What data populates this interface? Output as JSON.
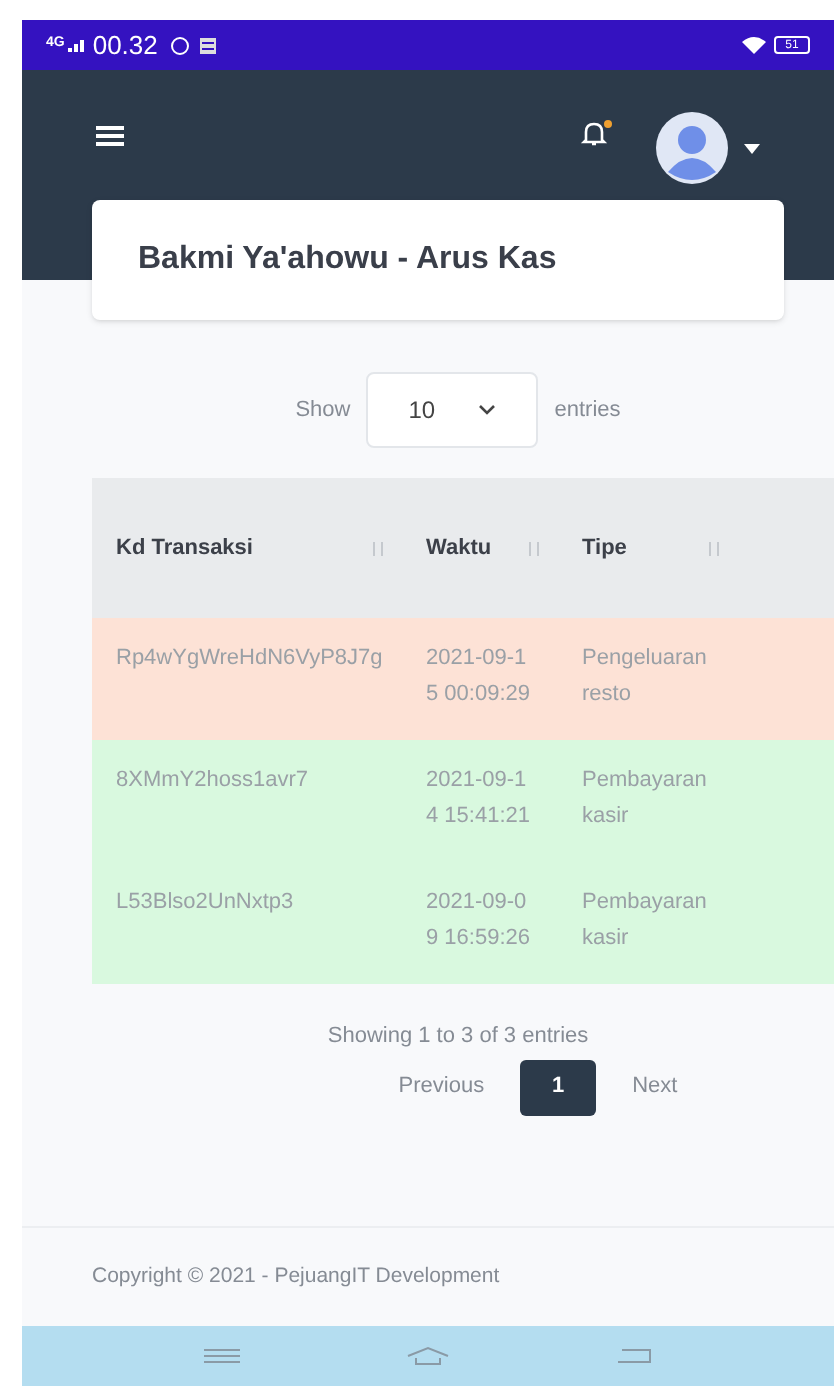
{
  "status_bar": {
    "network": "4G",
    "time": "00.32",
    "battery": "51"
  },
  "navbar": {
    "notification_dot": true
  },
  "card": {
    "title": "Bakmi Ya'ahowu - Arus Kas"
  },
  "length_menu": {
    "prefix": "Show",
    "value": "10",
    "suffix": "entries"
  },
  "table": {
    "columns": [
      {
        "label": "Kd Transaksi"
      },
      {
        "label": "Waktu"
      },
      {
        "label": "Tipe"
      }
    ],
    "rows": [
      {
        "color": "#fde2d6",
        "cells": [
          "Rp4wYgWreHdN6VyP8J7g",
          "2021-09-15 00:09:29",
          "Pengeluaran resto"
        ]
      },
      {
        "color": "#d9f9df",
        "cells": [
          "8XMmY2hoss1avr7",
          "2021-09-14 15:41:21",
          "Pembayaran kasir"
        ]
      },
      {
        "color": "#d9f9df",
        "cells": [
          "L53Blso2UnNxtp3",
          "2021-09-09 16:59:26",
          "Pembayaran kasir"
        ]
      }
    ]
  },
  "info": "Showing 1 to 3 of 3 entries",
  "pagination": [
    {
      "label": "Previous",
      "kind": "prev",
      "selected": false
    },
    {
      "label": "1",
      "kind": "page",
      "selected": true
    },
    {
      "label": "Next",
      "kind": "next",
      "selected": false
    }
  ],
  "footer": "Copyright © 2021 - PejuangIT Development"
}
